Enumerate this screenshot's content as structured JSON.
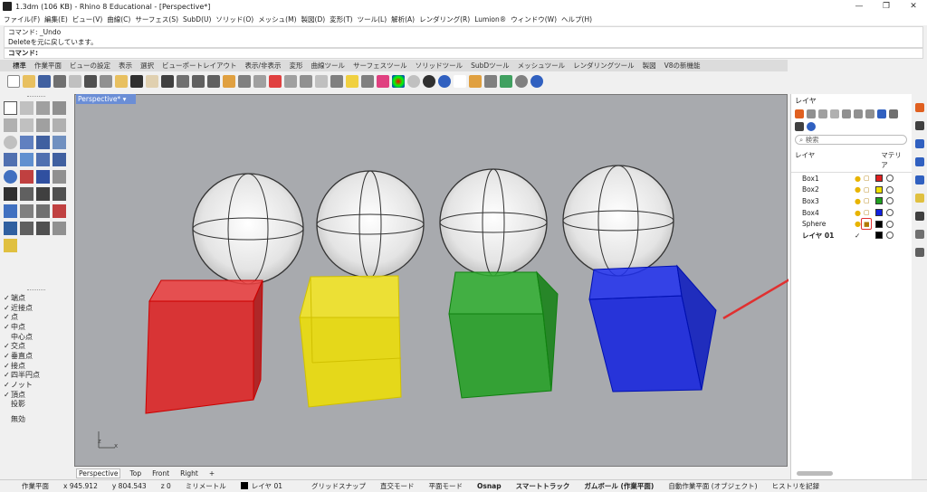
{
  "window": {
    "title": "1.3dm (106 KB) - Rhino 8 Educational - [Perspective*]",
    "controls": [
      "—",
      "❐",
      "✕"
    ]
  },
  "menu": [
    "ファイル(F)",
    "編集(E)",
    "ビュー(V)",
    "曲線(C)",
    "サーフェス(S)",
    "SubD(U)",
    "ソリッド(O)",
    "メッシュ(M)",
    "製図(D)",
    "変形(T)",
    "ツール(L)",
    "解析(A)",
    "レンダリング(R)",
    "Lumion®",
    "ウィンドウ(W)",
    "ヘルプ(H)"
  ],
  "command": {
    "history": [
      "コマンド: _Undo",
      "Deleteを元に戻しています。"
    ],
    "prompt": "コマンド:"
  },
  "toolbar_tabs": [
    "標準",
    "作業平面",
    "ビューの設定",
    "表示",
    "選択",
    "ビューポートレイアウト",
    "表示/非表示",
    "変形",
    "曲線ツール",
    "サーフェスツール",
    "ソリッドツール",
    "SubDツール",
    "メッシュツール",
    "レンダリングツール",
    "製図",
    "V8の新機能"
  ],
  "viewport": {
    "label": "Perspective*",
    "dropdown": "▾",
    "axis_z": "z",
    "axis_x": "x"
  },
  "view_tabs": [
    "Perspective",
    "Top",
    "Front",
    "Right",
    "+"
  ],
  "osnap": [
    {
      "label": "端点",
      "checked": true
    },
    {
      "label": "近接点",
      "checked": true
    },
    {
      "label": "点",
      "checked": true
    },
    {
      "label": "中点",
      "checked": true
    },
    {
      "label": "中心点",
      "checked": false
    },
    {
      "label": "交点",
      "checked": true
    },
    {
      "label": "垂直点",
      "checked": true
    },
    {
      "label": "接点",
      "checked": true
    },
    {
      "label": "四半円点",
      "checked": true
    },
    {
      "label": "ノット",
      "checked": true
    },
    {
      "label": "頂点",
      "checked": true
    },
    {
      "label": "投影",
      "checked": false
    }
  ],
  "osnap_disable": "無効",
  "layers_panel": {
    "title": "レイヤ",
    "search_placeholder": "検索",
    "col_layer": "レイヤ",
    "col_material": "マテリア",
    "layers": [
      {
        "name": "Box1",
        "color": "#e02020",
        "current": false
      },
      {
        "name": "Box2",
        "color": "#f0e000",
        "current": false
      },
      {
        "name": "Box3",
        "color": "#20a020",
        "current": false
      },
      {
        "name": "Box4",
        "color": "#1020e0",
        "current": false
      },
      {
        "name": "Sphere",
        "color": "#000000",
        "current": false
      },
      {
        "name": "レイヤ 01",
        "color": "#000000",
        "current": true,
        "check": "✓"
      }
    ]
  },
  "status": {
    "cplane": "作業平面",
    "x": "x 945.912",
    "y": "y 804.543",
    "z": "z 0",
    "units": "ミリメートル",
    "layer": "レイヤ 01",
    "items": [
      "グリッドスナップ",
      "直交モード",
      "平面モード"
    ],
    "osnap": "Osnap",
    "smarttrack": "スマートトラック",
    "gumball": "ガムボール (作業平面)",
    "auto_cplane": "自動作業平面 (オブジェクト)",
    "history": "ヒストリを記録"
  },
  "colors": {
    "red": "#e02020",
    "yellow": "#f0e000",
    "green": "#20a020",
    "blue": "#1020e0",
    "viewport_bg": "#a8aaae",
    "arrow": "#e03030"
  }
}
